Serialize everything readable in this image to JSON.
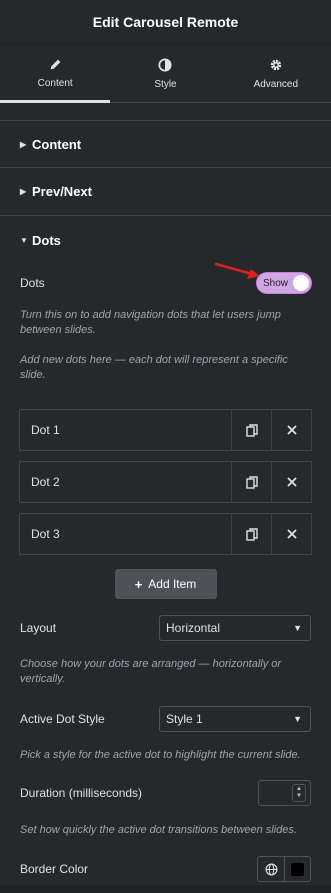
{
  "header": {
    "title": "Edit Carousel Remote"
  },
  "tabs": [
    {
      "label": "Content",
      "icon": "pencil-icon",
      "active": true
    },
    {
      "label": "Style",
      "icon": "contrast-icon",
      "active": false
    },
    {
      "label": "Advanced",
      "icon": "gear-icon",
      "active": false
    }
  ],
  "sections": {
    "content": {
      "label": "Content"
    },
    "prevnext": {
      "label": "Prev/Next"
    },
    "dots": {
      "label": "Dots"
    }
  },
  "dots_toggle": {
    "label": "Dots",
    "state_label": "Show",
    "on": true,
    "accent_color": "#d0a7e3"
  },
  "desc": {
    "dots_toggle": "Turn this on to add navigation dots that let users jump between slides.",
    "add_dots": "Add new dots here — each dot will represent a specific slide.",
    "layout": "Choose how your dots are arranged — horizontally or vertically.",
    "active_style": "Pick a style for the active dot to highlight the current slide.",
    "duration": "Set how quickly the active dot transitions between slides."
  },
  "repeater": {
    "items": [
      {
        "title": "Dot 1"
      },
      {
        "title": "Dot 2"
      },
      {
        "title": "Dot 3"
      }
    ],
    "add_label": "Add Item"
  },
  "layout": {
    "label": "Layout",
    "value": "Horizontal"
  },
  "active_dot_style": {
    "label": "Active Dot Style",
    "value": "Style 1"
  },
  "duration": {
    "label": "Duration (milliseconds)",
    "value": ""
  },
  "border_color": {
    "label": "Border Color",
    "swatch": "#000000"
  }
}
